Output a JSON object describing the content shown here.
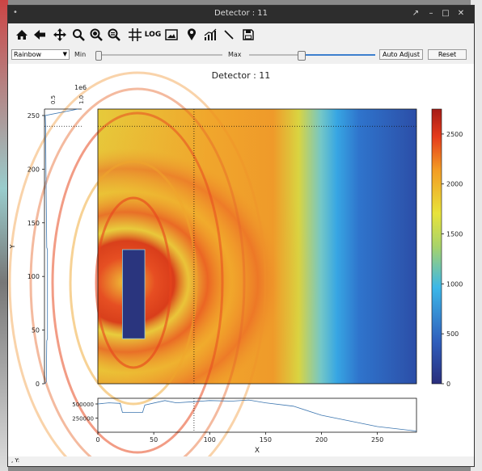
{
  "window": {
    "title": "Detector : 11",
    "menu_dot": "•"
  },
  "titlebar_buttons": {
    "pin": "↗",
    "min": "–",
    "max": "□",
    "close": "✕"
  },
  "toolbar": {
    "log_label": "LOG",
    "icons": [
      "home-icon",
      "back-icon",
      "pan-icon",
      "zoom-icon",
      "zoom-in-icon",
      "zoom-out-icon",
      "grid-icon",
      "log-scale-icon",
      "image-icon",
      "marker-icon",
      "profile-icon",
      "line-icon",
      "save-icon"
    ]
  },
  "controls": {
    "colormap": "Rainbow",
    "min_label": "Min",
    "max_label": "Max",
    "max_level": 0.41,
    "auto_adjust_label": "Auto Adjust",
    "reset_label": "Reset"
  },
  "plot": {
    "title": "Detector : 11",
    "xlabel": "X",
    "ylabel": "Y",
    "x_ticks": [
      "0",
      "50",
      "100",
      "150",
      "200",
      "250"
    ],
    "y_ticks": [
      "0",
      "50",
      "100",
      "150",
      "200",
      "250"
    ],
    "colorbar_ticks": [
      "0",
      "500",
      "1000",
      "1500",
      "2000",
      "2500"
    ],
    "side_offset": "1e6",
    "side_ticks": [
      "0.5",
      "1.0"
    ],
    "bottom_ticks": [
      "250000",
      "500000"
    ]
  },
  "status": {
    "text": ", Y:"
  },
  "chart_data": [
    {
      "type": "heatmap",
      "title": "Detector : 11",
      "xlabel": "X",
      "ylabel": "Y",
      "xlim": [
        0,
        285
      ],
      "ylim": [
        0,
        256
      ],
      "colormap": "Rainbow",
      "colorbar_range": [
        0,
        2750
      ],
      "crosshair": {
        "x": 86,
        "y": 240
      },
      "masked_rect": {
        "x": [
          22,
          42
        ],
        "y": [
          42,
          125
        ]
      }
    },
    {
      "type": "line",
      "name": "row sum",
      "x": [
        0,
        10,
        20,
        22,
        40,
        42,
        60,
        70,
        86,
        100,
        120,
        135,
        150,
        175,
        200,
        225,
        250,
        285
      ],
      "values": [
        500000,
        520000,
        510000,
        350000,
        350000,
        480000,
        560000,
        520000,
        540000,
        560000,
        550000,
        570000,
        520000,
        460000,
        300000,
        200000,
        100000,
        20000
      ],
      "yticks": [
        250000,
        500000
      ]
    },
    {
      "type": "line",
      "name": "column sum",
      "y": [
        0,
        2,
        40,
        42,
        125,
        127,
        200,
        240,
        250,
        256
      ],
      "values": [
        0.02,
        0.05,
        0.06,
        0.08,
        0.08,
        0.06,
        0.04,
        0.03,
        0.02,
        0.9
      ],
      "xticks": [
        0.5,
        1.0
      ],
      "offset": "1e6"
    }
  ]
}
